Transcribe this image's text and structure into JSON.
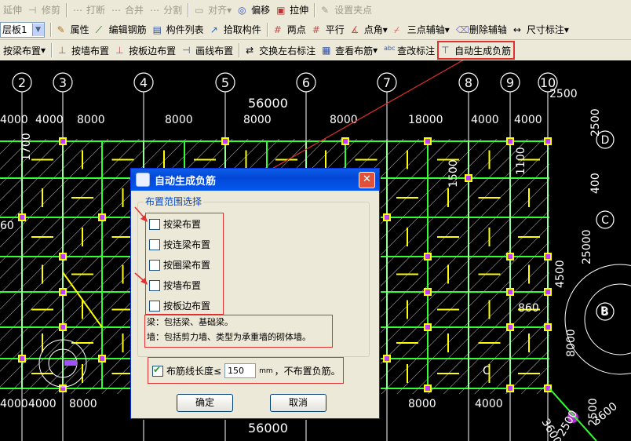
{
  "toolbar1": {
    "items": [
      "延伸",
      "修剪",
      "打断",
      "合并",
      "分割",
      "对齐",
      "偏移",
      "拉伸",
      "设置夹点"
    ]
  },
  "toolbar2": {
    "layer_select": "层板1",
    "items": [
      "属性",
      "编辑钢筋",
      "构件列表",
      "拾取构件",
      "两点",
      "平行",
      "点角",
      "三点辅轴",
      "删除辅轴",
      "尺寸标注"
    ]
  },
  "toolbar3": {
    "items": [
      "按梁布置",
      "按墙布置",
      "按板边布置",
      "画线布置",
      "交换左右标注",
      "查看布筋",
      "查改标注",
      "自动生成负筋"
    ]
  },
  "cad": {
    "axis_numbers": [
      "2",
      "3",
      "4",
      "5",
      "6",
      "7",
      "8",
      "9",
      "10"
    ],
    "axis_letters": [
      "D",
      "C",
      "B"
    ],
    "top_total": "56000",
    "bottom_total": "56000",
    "top_dims": [
      "4000",
      "4000",
      "8000",
      "8000",
      "8000",
      "8000",
      "18000",
      "4000",
      "4000",
      "2500"
    ],
    "bottom_dims": [
      "4000",
      "4000",
      "8000",
      "8000",
      "4000"
    ],
    "right_dims": [
      "2500",
      "400",
      "25000",
      "4500",
      "8000",
      "2500"
    ],
    "misc_dims": [
      "1700",
      "1500",
      "1100",
      "860",
      "60",
      "3600",
      "3600",
      "2500"
    ],
    "colors": {
      "axis": "#ffffff",
      "grid": "#32ff32",
      "rebar": "#ffff00",
      "beam": "#dcdcdc"
    }
  },
  "dialog": {
    "title": "自动生成负筋",
    "group_title": "布置范围选择",
    "options": [
      {
        "label": "按梁布置",
        "checked": false
      },
      {
        "label": "按连梁布置",
        "checked": false
      },
      {
        "label": "按圈梁布置",
        "checked": false
      },
      {
        "label": "按墙布置",
        "checked": false
      },
      {
        "label": "按板边布置",
        "checked": false
      }
    ],
    "note_line1": "梁：包括梁、基础梁。",
    "note_line2": "墙：包括剪力墙、类型为承重墙的砌体墙。",
    "length_check": true,
    "length_label": "布筋线长度≤",
    "length_value": "150",
    "length_unit": "mm",
    "length_suffix": "，不布置负筋。",
    "ok": "确定",
    "cancel": "取消"
  }
}
